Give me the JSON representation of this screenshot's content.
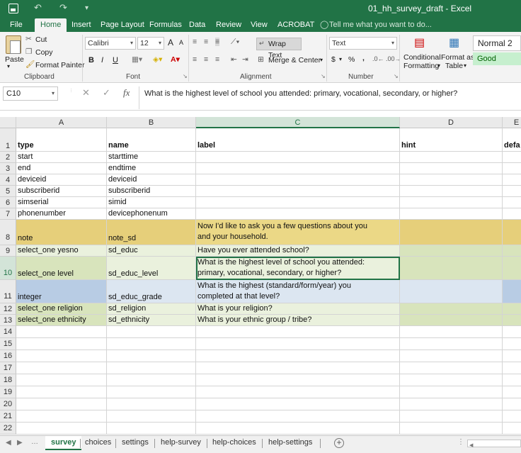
{
  "window": {
    "title": "01_hh_survey_draft - Excel"
  },
  "quick_access": {
    "undo": "↶",
    "redo": "↷",
    "customize": "▾"
  },
  "tabs": [
    "File",
    "Home",
    "Insert",
    "Page Layout",
    "Formulas",
    "Data",
    "Review",
    "View",
    "ACROBAT"
  ],
  "tell_me": "Tell me what you want to do...",
  "ribbon": {
    "clipboard": {
      "paste": "Paste",
      "cut": "Cut",
      "copy": "Copy",
      "format_painter": "Format Painter",
      "label": "Clipboard"
    },
    "font": {
      "name": "Calibri",
      "size": "12",
      "bold": "B",
      "italic": "I",
      "underline": "U",
      "grow": "A",
      "shrink": "A",
      "label": "Font"
    },
    "alignment": {
      "wrap_text": "Wrap Text",
      "merge_center": "Merge & Center",
      "label": "Alignment"
    },
    "number": {
      "format": "Text",
      "currency": "$",
      "percent": "%",
      "comma": ",",
      "label": "Number"
    },
    "styles": {
      "conditional": "Conditional",
      "formatting": "Formatting",
      "format_as": "Format as",
      "table": "Table",
      "normal": "Normal 2",
      "good": "Good"
    }
  },
  "formula_bar": {
    "cell_ref": "C10",
    "fx": "fx",
    "content": "What is the highest level of school you attended: primary, vocational, secondary, or higher?"
  },
  "columns": [
    "A",
    "B",
    "C",
    "D",
    "E"
  ],
  "rows": [
    {
      "num": "1",
      "a": "type",
      "b": "name",
      "c": "label",
      "d": "hint",
      "e": "defa"
    },
    {
      "num": "2",
      "a": "start",
      "b": "starttime",
      "c": "",
      "d": "",
      "e": ""
    },
    {
      "num": "3",
      "a": "end",
      "b": "endtime",
      "c": "",
      "d": "",
      "e": ""
    },
    {
      "num": "4",
      "a": "deviceid",
      "b": "deviceid",
      "c": "",
      "d": "",
      "e": ""
    },
    {
      "num": "5",
      "a": "subscriberid",
      "b": "subscriberid",
      "c": "",
      "d": "",
      "e": ""
    },
    {
      "num": "6",
      "a": "simserial",
      "b": "simid",
      "c": "",
      "d": "",
      "e": ""
    },
    {
      "num": "7",
      "a": "phonenumber",
      "b": "devicephonenum",
      "c": "",
      "d": "",
      "e": ""
    },
    {
      "num": "8",
      "a": "note",
      "b": "note_sd",
      "c1": "Now I'd like to ask you a few questions about you",
      "c2": "and your household.",
      "d": "",
      "e": ""
    },
    {
      "num": "9",
      "a": "select_one yesno",
      "b": "sd_educ",
      "c": "Have you ever attended school?",
      "d": "",
      "e": ""
    },
    {
      "num": "10",
      "a": "select_one level",
      "b": "sd_educ_level",
      "c1": "What is the highest level of school you attended:",
      "c2": "primary, vocational, secondary, or higher?",
      "d": "",
      "e": ""
    },
    {
      "num": "11",
      "a": "integer",
      "b": "sd_educ_grade",
      "c1": "What is the highest (standard/form/year) you",
      "c2": "completed at that level?",
      "d": "",
      "e": ""
    },
    {
      "num": "12",
      "a": "select_one religion",
      "b": "sd_religion",
      "c": "What is your religion?",
      "d": "",
      "e": ""
    },
    {
      "num": "13",
      "a": "select_one ethnicity",
      "b": "sd_ethnicity",
      "c": "What is your ethnic group / tribe?",
      "d": "",
      "e": ""
    }
  ],
  "empty_rows": [
    "14",
    "15",
    "16",
    "17",
    "18",
    "19",
    "20",
    "21",
    "22"
  ],
  "sheet_tabs": [
    "survey",
    "choices",
    "settings",
    "help-survey",
    "help-choices",
    "help-settings"
  ],
  "active_sheet": "survey"
}
